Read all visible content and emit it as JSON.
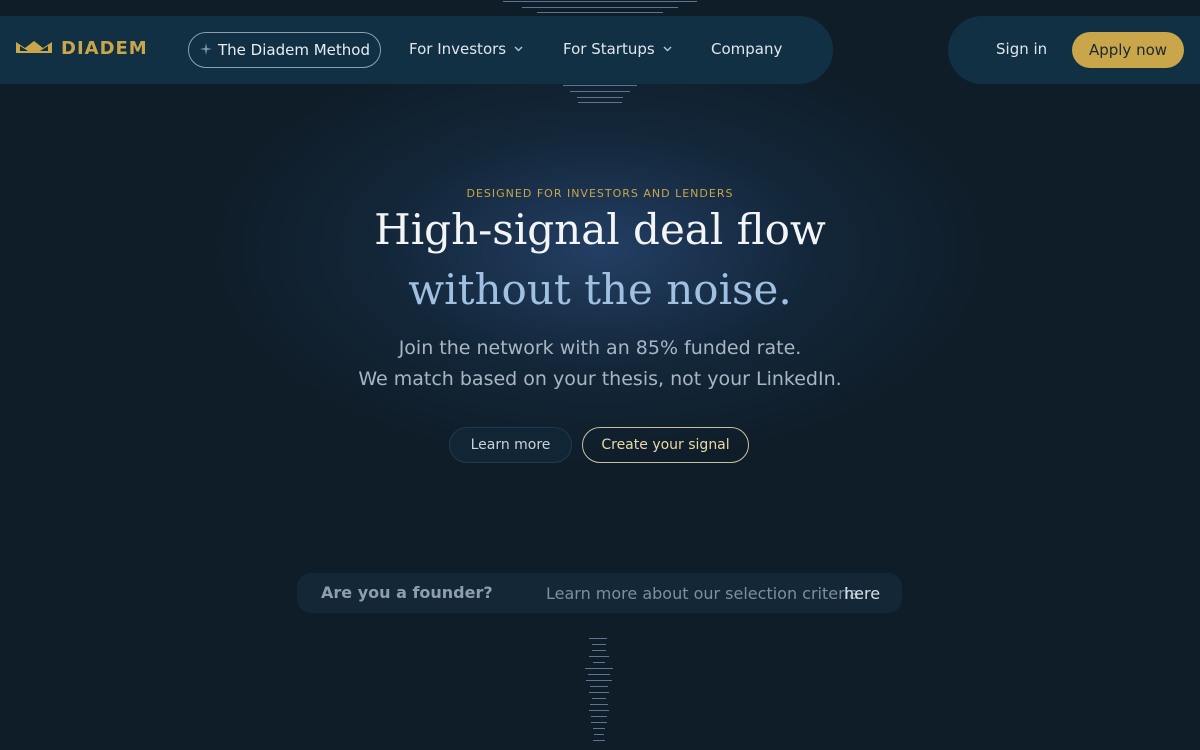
{
  "nav": {
    "brand": "DIADEM",
    "method": "The Diadem Method",
    "investors": "For Investors",
    "startups": "For Startups",
    "company": "Company",
    "sign_in": "Sign in",
    "apply": "Apply now"
  },
  "hero": {
    "eyebrow": "DESIGNED FOR INVESTORS AND LENDERS",
    "title_line1": "High-signal deal flow",
    "title_line2": "without the noise.",
    "sub_line1": "Join the network with an 85% funded rate.",
    "sub_line2": "We match based on your thesis, not your LinkedIn.",
    "learn_more": "Learn more",
    "create_signal": "Create your signal"
  },
  "founder": {
    "question": "Are you a founder?",
    "text": "Learn more about our selection criteria",
    "link": "here"
  },
  "icons": {
    "logo": "crown-icon",
    "method": "sparkle-icon",
    "dropdown": "chevron-down-icon"
  },
  "colors": {
    "background": "#0f1d29",
    "nav": "#123044",
    "accent_gold": "#c9a649",
    "title_blue": "#9fc0e0"
  }
}
